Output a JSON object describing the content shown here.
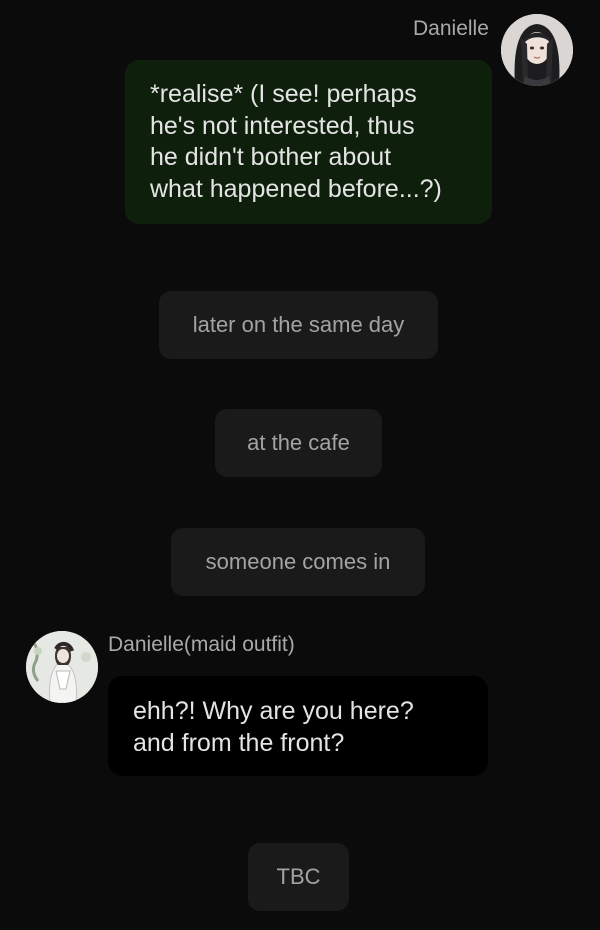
{
  "messages": [
    {
      "sender": "Danielle",
      "side": "right",
      "avatar_icon": "danielle-avatar-icon",
      "text": "*realise* (I see! perhaps\nhe's not interested, thus\nhe didn't bother about\nwhat happened before...?)"
    },
    {
      "sender": "Danielle(maid outfit)",
      "side": "left",
      "avatar_icon": "danielle-maid-avatar-icon",
      "text": "ehh?! Why are you here?\nand from the front?"
    }
  ],
  "narrations": [
    "later on the same day",
    "at the cafe",
    "someone comes in",
    "TBC"
  ],
  "colors": {
    "background": "#0b0b0b",
    "user_bubble": "#0e200c",
    "character_bubble": "#000000",
    "narration_pill": "#1a1a1a",
    "message_text": "#e4e4e4",
    "muted_text": "#a3a3a3"
  }
}
